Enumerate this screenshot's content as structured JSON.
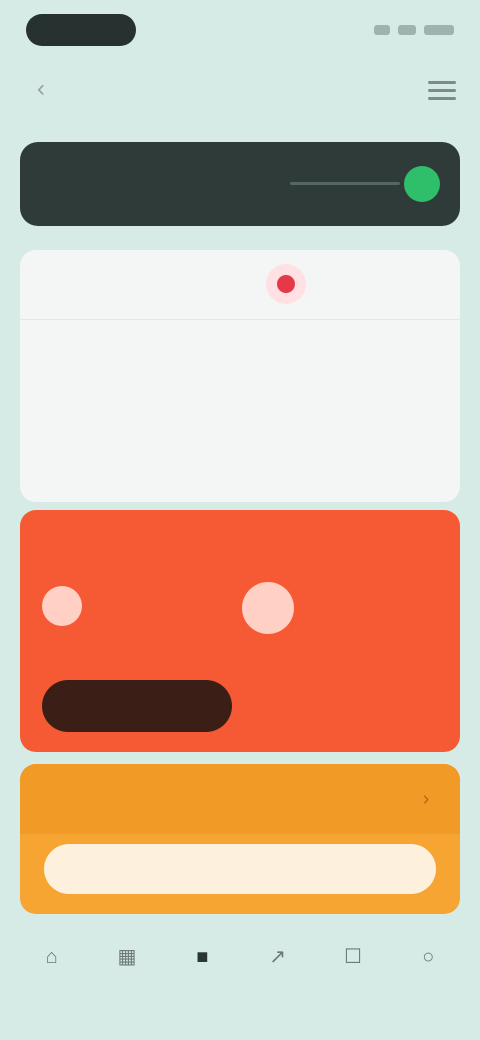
{
  "status_bar": {
    "time": ""
  },
  "header": {
    "title": ""
  },
  "dark_card": {
    "title": "",
    "subtitle": ""
  },
  "white_card": {
    "top_left_title": "",
    "top_right_label": "",
    "left_column": {
      "title": "",
      "stats": [
        {
          "value": "",
          "label": ""
        },
        {
          "value": "",
          "label": ""
        }
      ]
    },
    "right_column": {
      "title": "",
      "stats": [
        {
          "value": "",
          "label": ""
        },
        {
          "value": "",
          "label": ""
        }
      ]
    }
  },
  "red_card": {
    "title": "",
    "dot_labels": [
      "",
      ""
    ],
    "primary_button": "",
    "secondary_link": ""
  },
  "orange_card": {
    "title": "",
    "button": ""
  },
  "tab_bar": {
    "tabs": [
      {
        "icon": "home-icon",
        "glyph": "⌂",
        "label": ""
      },
      {
        "icon": "calendar-icon",
        "glyph": "▦",
        "label": ""
      },
      {
        "icon": "grid-icon",
        "glyph": "■",
        "label": ""
      },
      {
        "icon": "chart-icon",
        "glyph": "↗",
        "label": ""
      },
      {
        "icon": "chat-icon",
        "glyph": "☐",
        "label": ""
      },
      {
        "icon": "profile-icon",
        "glyph": "○",
        "label": ""
      }
    ]
  }
}
